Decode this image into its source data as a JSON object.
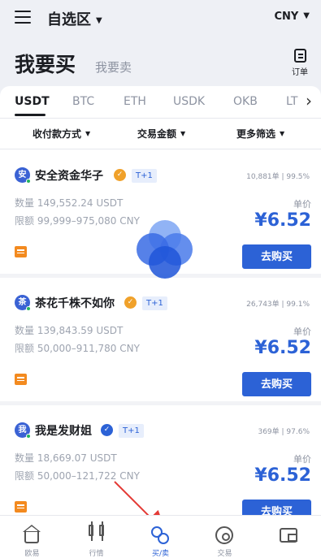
{
  "topbar": {
    "title": "自选区",
    "currency": "CNY"
  },
  "header": {
    "buy_tab": "我要买",
    "sell_tab": "我要卖",
    "orders_label": "订单"
  },
  "coin_tabs": [
    "USDT",
    "BTC",
    "ETH",
    "USDK",
    "OKB",
    "LT"
  ],
  "filters": [
    "收付款方式",
    "交易金额",
    "更多筛选"
  ],
  "common": {
    "unit_label": "单价",
    "buy_label": "去购买",
    "t_plus": "T+1"
  },
  "merchants": [
    {
      "avatar": "安",
      "name": "安全资金华子",
      "stats": "10,881单 | 99.5%",
      "quantity": "数量 149,552.24 USDT",
      "limit": "限额 99,999–975,080 CNY",
      "price": "¥6.52"
    },
    {
      "avatar": "茶",
      "name": "茶花千株不如你",
      "stats": "26,743单 | 99.1%",
      "quantity": "数量 139,843.59 USDT",
      "limit": "限额 50,000–911,780 CNY",
      "price": "¥6.52"
    },
    {
      "avatar": "我",
      "name": "我是发财姐",
      "stats": "369单 | 97.6%",
      "quantity": "数量 18,669.07 USDT",
      "limit": "限额 50,000–121,722 CNY",
      "price": "¥6.52"
    }
  ],
  "bottom_nav": [
    "欧易",
    "行情",
    "买/卖",
    "交易",
    ""
  ],
  "colors": {
    "accent": "#2c62d6",
    "orange": "#f38a1f",
    "arrow": "#e43b36"
  }
}
